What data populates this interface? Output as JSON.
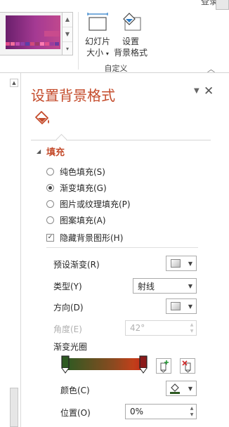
{
  "account": {
    "login_label": "登录"
  },
  "ribbon": {
    "theme_swatch_colors": [
      "#e24a8a",
      "#f06d9b",
      "#c44bb0",
      "#8e3fa8",
      "#5a3fa8",
      "#d04a7a",
      "#a03a6a",
      "#ff7ab0",
      "#e0508c",
      "#9a3c9e",
      "#6c3aa0"
    ],
    "slide_size_label_line1": "幻灯片",
    "slide_size_label_line2": "大小",
    "format_bg_label_line1": "设置",
    "format_bg_label_line2": "背景格式",
    "group_label": "自定义"
  },
  "panel": {
    "title": "设置背景格式",
    "fill_section": "填充",
    "options": [
      {
        "label": "纯色填充(S)",
        "selected": false
      },
      {
        "label": "渐变填充(G)",
        "selected": true
      },
      {
        "label": "图片或纹理填充(P)",
        "selected": false
      },
      {
        "label": "图案填充(A)",
        "selected": false
      }
    ],
    "hide_bg_graphics": {
      "label": "隐藏背景图形(H)",
      "checked": true
    },
    "preset_gradient_label": "预设渐变(R)",
    "type_label": "类型(Y)",
    "type_value": "射线",
    "direction_label": "方向(D)",
    "angle_label": "角度(E)",
    "angle_value": "42°",
    "gradient_stops_label": "渐变光圈",
    "color_label": "颜色(C)",
    "position_label": "位置(O)",
    "position_value": "0%",
    "colors": {
      "accent": "#c44b2b",
      "stop_left": "#2e5a22",
      "stop_right": "#8b1a1a"
    }
  }
}
